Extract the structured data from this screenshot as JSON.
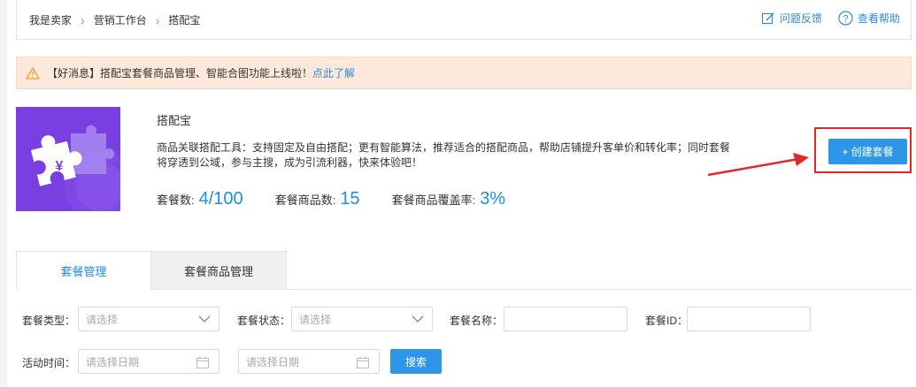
{
  "breadcrumb": [
    "我是卖家",
    "营销工作台",
    "搭配宝"
  ],
  "help": {
    "feedback": "问题反馈",
    "help": "查看帮助"
  },
  "notice": {
    "text": "【好消息】搭配宝套餐商品管理、智能合图功能上线啦！",
    "link": "点此了解"
  },
  "app": {
    "title": "搭配宝",
    "description": "商品关联搭配工具：支持固定及自由搭配；更有智能算法，推荐适合的搭配商品，帮助店铺提升客单价和转化率；同时套餐将穿透到公域，参与主搜，成为引流利器，快来体验吧！",
    "logo_glyph": "¥",
    "logo_color": "#7a3fe0"
  },
  "stats": [
    {
      "label": "套餐数:",
      "value": "4/100"
    },
    {
      "label": "套餐商品数:",
      "value": "15"
    },
    {
      "label": "套餐商品覆盖率:",
      "value": "3%"
    }
  ],
  "create_button": "+ 创建套餐",
  "tabs": [
    {
      "label": "套餐管理",
      "active": true
    },
    {
      "label": "套餐商品管理",
      "active": false
    }
  ],
  "filters": {
    "type_label": "套餐类型：",
    "type_placeholder": "请选择",
    "status_label": "套餐状态：",
    "status_placeholder": "请选择",
    "name_label": "套餐名称：",
    "id_label": "套餐ID：",
    "time_label": "活动时间：",
    "date_placeholder_start": "请选择日期",
    "date_placeholder_end": "请选择日期",
    "search_button": "搜索"
  },
  "colors": {
    "accent": "#2d96e8",
    "highlight": "#e02a2a",
    "notice_bg": "#fde9dc",
    "warning": "#f0a030"
  }
}
